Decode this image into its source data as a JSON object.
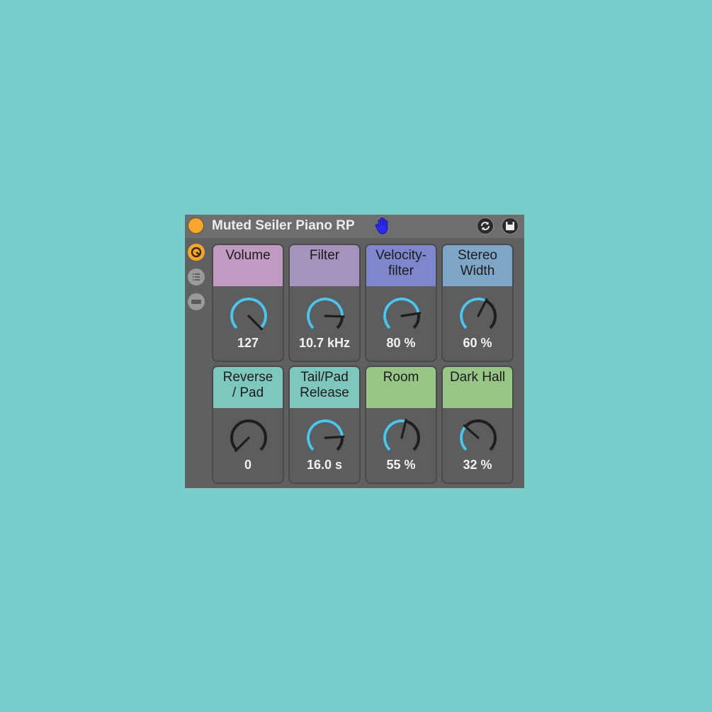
{
  "device": {
    "title": "Muted Seiler Piano RP",
    "icons": {
      "power": "power-icon",
      "hand": "hand-icon",
      "sync": "sync-icon",
      "save": "save-icon",
      "sidebar": [
        "macro-icon",
        "list-icon",
        "minimize-icon"
      ]
    }
  },
  "colors": {
    "background": "#79cdca",
    "device": "#5f6061",
    "power": "#f4a62f",
    "knob_arc": "#4fc3ea",
    "knob_track": "#1e1e1e"
  },
  "macros": [
    {
      "label": [
        "Volume"
      ],
      "value": "127",
      "fraction": 1.0,
      "color": "#c09ac0"
    },
    {
      "label": [
        "Filter"
      ],
      "value": "10.7 kHz",
      "fraction": 0.84,
      "color": "#a493bd"
    },
    {
      "label": [
        "Velocity-",
        "filter"
      ],
      "value": "80 %",
      "fraction": 0.8,
      "color": "#7e86cc"
    },
    {
      "label": [
        "Stereo",
        "Width"
      ],
      "value": "60 %",
      "fraction": 0.6,
      "color": "#7fa6c6"
    },
    {
      "label": [
        "Reverse",
        "/ Pad"
      ],
      "value": "0",
      "fraction": 0.0,
      "color": "#7ec7bc"
    },
    {
      "label": [
        "Tail/Pad",
        "Release"
      ],
      "value": "16.0 s",
      "fraction": 0.82,
      "color": "#7ec7bc"
    },
    {
      "label": [
        "Room"
      ],
      "value": "55 %",
      "fraction": 0.55,
      "color": "#97c686"
    },
    {
      "label": [
        "Dark Hall"
      ],
      "value": "32 %",
      "fraction": 0.32,
      "color": "#97c686"
    }
  ]
}
